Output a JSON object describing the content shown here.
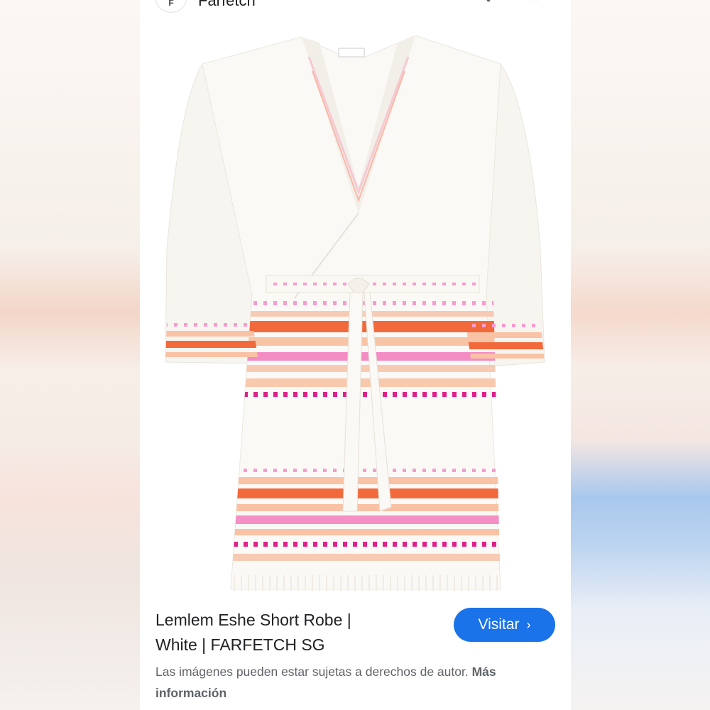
{
  "header": {
    "site_name": "Farfetch"
  },
  "result": {
    "title_line1": "Lemlem Eshe Short Robe |",
    "title_line2": "White | FARFETCH SG",
    "visit_label": "Visitar",
    "note_text": "Las imágenes pueden estar sujetas a derechos de autor.",
    "more_info_label": "Más información"
  },
  "colors": {
    "accent": "#1a73e8",
    "stripe_orange": "#f26a3c",
    "stripe_pink": "#f28fc6",
    "stripe_peach": "#f9c2a4",
    "stripe_magenta": "#e0208a"
  }
}
